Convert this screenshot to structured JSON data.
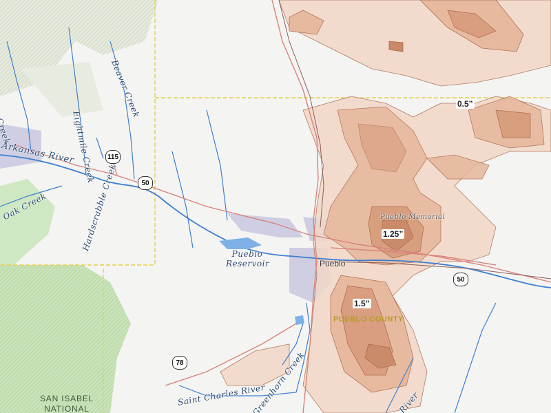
{
  "map": {
    "contour_labels": {
      "a": "0.5”",
      "b": "1.25”",
      "c": "1.5”"
    },
    "waterways": {
      "fourmile": "Fourmile Creek",
      "beaver": "Beaver Creek",
      "eightmile": "Eightmile Creek",
      "arkansas": "Arkansas River",
      "oak": "Oak Creek",
      "hardscrabble": "Hardscrabble Creek",
      "reservoir": "Pueblo Reservoir",
      "stcharles": "Saint Charles River",
      "greenhorn": "Greenhorn Creek",
      "river_se": "River"
    },
    "places": {
      "pueblo": "Pueblo",
      "pueblo_memorial": "Pueblo Memorial",
      "county": "PUEBLO COUNTY",
      "forest_line1": "SAN ISABEL",
      "forest_line2": "NATIONAL"
    },
    "routes": {
      "r115": "115",
      "r50w": "50",
      "r50e": "50",
      "r78": "78"
    },
    "colors": {
      "precip_light": "#f2d7c6",
      "precip_mid": "#e6b79b",
      "precip_dark": "#c98a69",
      "contour_stroke": "#a8674a",
      "water": "#3d7fd1",
      "road": "#d9837c",
      "county_line": "#e6cf4f",
      "forest": "#b9dca8"
    }
  }
}
